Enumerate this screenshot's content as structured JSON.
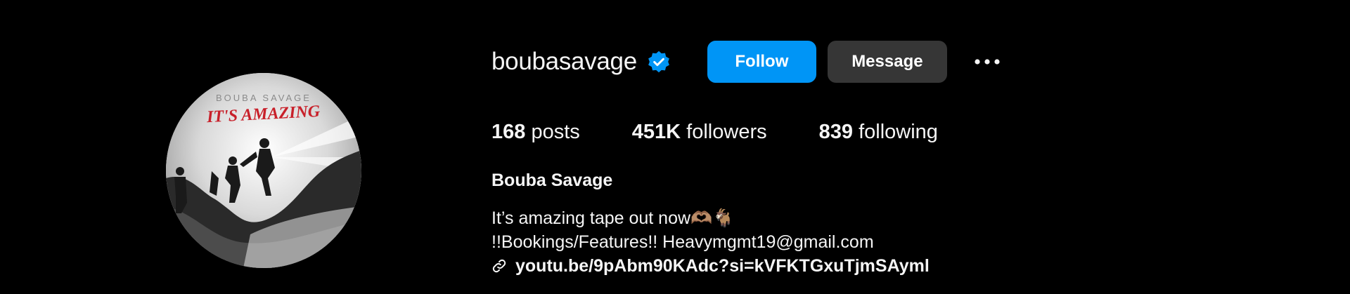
{
  "profile": {
    "username": "boubasavage",
    "verified": true,
    "full_name": "Bouba Savage",
    "bio_line_1": "It’s amazing tape out now🫶🏽🐐",
    "bio_line_2": "!!Bookings/Features!! Heavymgmt19@gmail.com",
    "link": "youtu.be/9pAbm90KAdc?si=kVFKTGxuTjmSAyml"
  },
  "avatar": {
    "cover_artist_text": "BOUBA SAVAGE",
    "cover_title_text": "IT'S AMAZING"
  },
  "actions": {
    "follow_label": "Follow",
    "message_label": "Message",
    "more_icon": "more-horizontal-icon"
  },
  "stats": {
    "posts_count": "168",
    "posts_label": "posts",
    "followers_count": "451K",
    "followers_label": "followers",
    "following_count": "839",
    "following_label": "following"
  },
  "colors": {
    "background": "#000000",
    "follow_button": "#0095f6",
    "message_button": "#363636",
    "verified_badge": "#0095f6",
    "text": "#f5f5f5",
    "cover_title_red": "#c8202a"
  }
}
